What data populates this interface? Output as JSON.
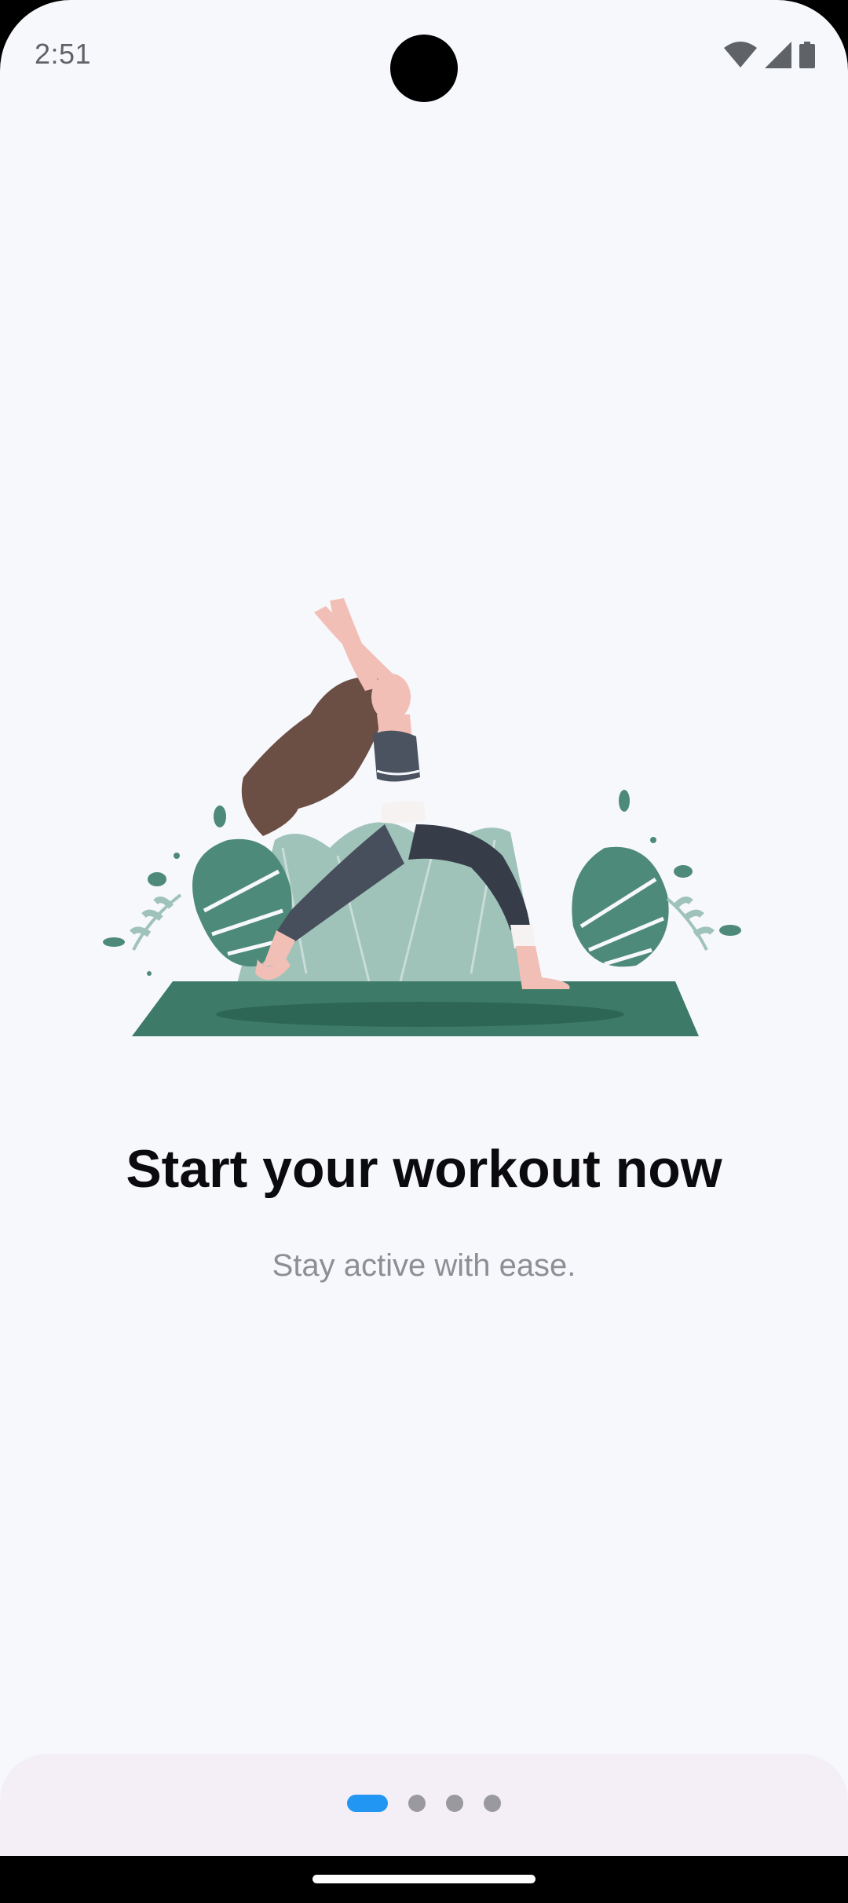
{
  "status_bar": {
    "time": "2:51",
    "icons": [
      "wifi-icon",
      "cellular-signal-icon",
      "battery-icon"
    ]
  },
  "onboarding": {
    "illustration": "woman-yoga-warrior-pose-illustration",
    "title": "Start your workout now",
    "subtitle": "Stay active with ease.",
    "page_indicator": {
      "total": 4,
      "current": 1
    }
  },
  "colors": {
    "background": "#f7f8fc",
    "accent": "#2196f3",
    "inactive_dot": "#9a9a9e",
    "bottom_panel": "#f4eff7",
    "foliage": "#4e8a7a",
    "mat": "#3d7a68"
  }
}
